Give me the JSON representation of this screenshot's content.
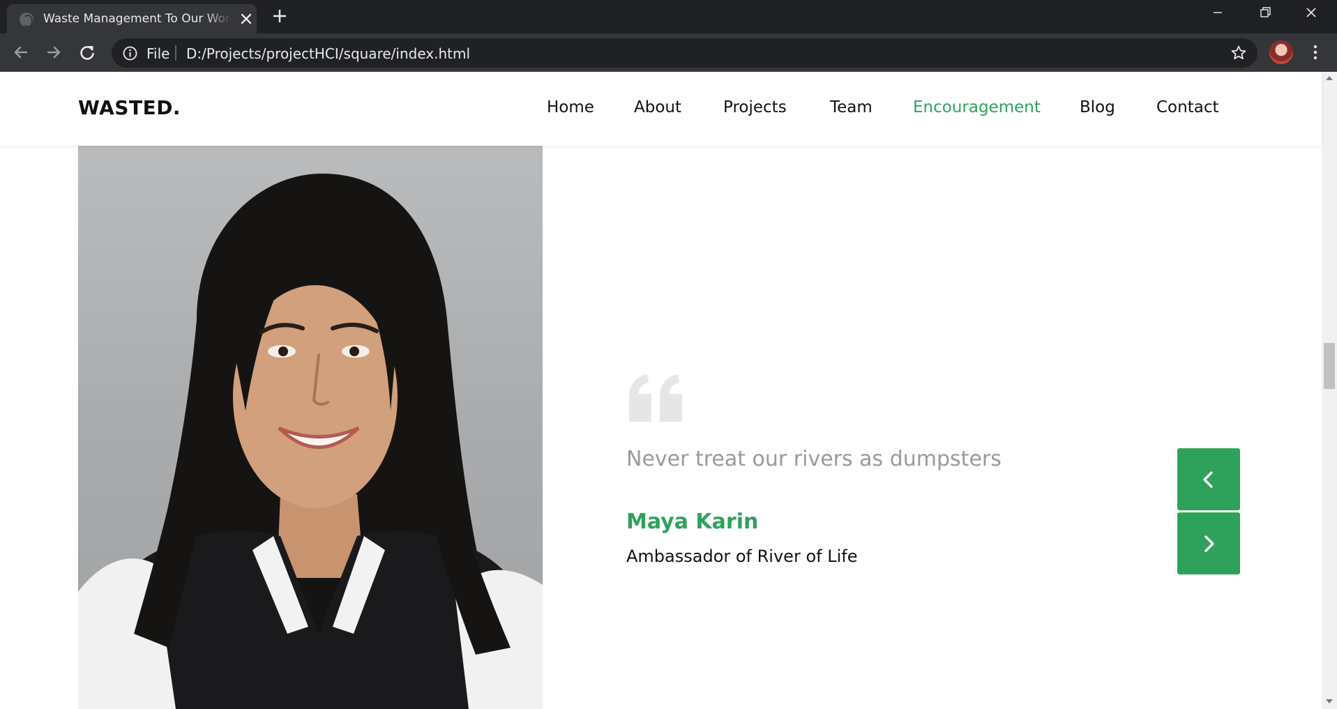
{
  "browser": {
    "tab_title": "Waste Management To Our World",
    "address_scheme_label": "File",
    "url": "D:/Projects/projectHCI/square/index.html"
  },
  "site": {
    "logo": "WASTED.",
    "nav": [
      {
        "label": "Home",
        "active": false
      },
      {
        "label": "About",
        "active": false
      },
      {
        "label": "Projects",
        "active": false
      },
      {
        "label": "Team",
        "active": false
      },
      {
        "label": "Encouragement",
        "active": true
      },
      {
        "label": "Blog",
        "active": false
      },
      {
        "label": "Contact",
        "active": false
      }
    ],
    "accent_color": "#2ea25a"
  },
  "testimonial": {
    "quote": "Never treat our rivers as dumpsters",
    "author": "Maya Karin",
    "role": "Ambassador of River of Life",
    "portrait_icon": "portrait-photo",
    "prev_icon": "chevron-left-icon",
    "next_icon": "chevron-right-icon"
  }
}
